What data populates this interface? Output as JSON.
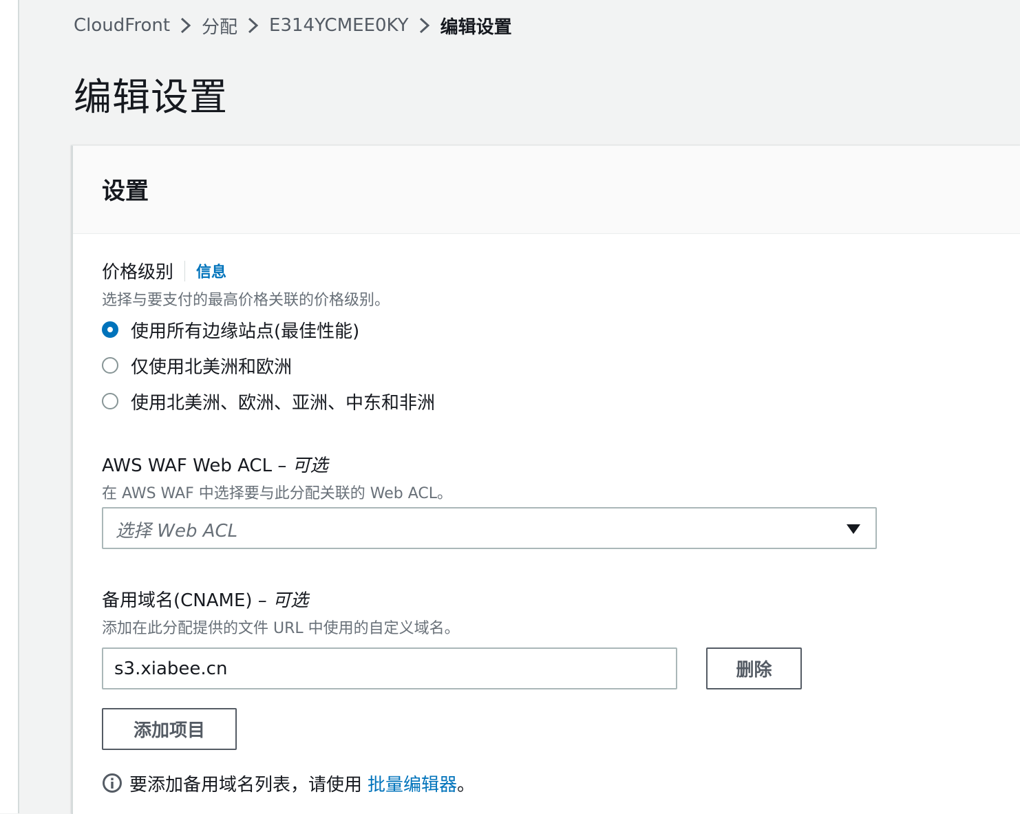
{
  "breadcrumb": {
    "items": [
      "CloudFront",
      "分配",
      "E314YCMEE0KY"
    ],
    "current": "编辑设置"
  },
  "page": {
    "title": "编辑设置"
  },
  "panel": {
    "title": "设置"
  },
  "price_class": {
    "label": "价格级别",
    "info_link": "信息",
    "description": "选择与要支付的最高价格关联的价格级别。",
    "options": [
      {
        "label": "使用所有边缘站点(最佳性能)",
        "selected": true
      },
      {
        "label": "仅使用北美洲和欧洲",
        "selected": false
      },
      {
        "label": "使用北美洲、欧洲、亚洲、中东和非洲",
        "selected": false
      }
    ]
  },
  "waf": {
    "label": "AWS WAF Web ACL – ",
    "optional": "可选",
    "description": "在 AWS WAF 中选择要与此分配关联的 Web ACL。",
    "placeholder": "选择 Web ACL"
  },
  "cname": {
    "label": "备用域名(CNAME) – ",
    "optional": "可选",
    "description": "添加在此分配提供的文件 URL 中使用的自定义域名。",
    "value": "s3.xiabee.cn",
    "remove_label": "删除",
    "add_label": "添加项目",
    "hint_text": "要添加备用域名列表，请使用",
    "hint_link": "批量编辑器",
    "hint_end": "。"
  },
  "colors": {
    "accent": "#0073bb",
    "link_muted": "#545b64",
    "page_bg": "#f2f3f3",
    "panel_header_bg": "#fafafa"
  },
  "icons": {
    "breadcrumb_separator": "chevron-right-icon",
    "select_caret": "caret-down-icon",
    "hint": "info-icon"
  }
}
